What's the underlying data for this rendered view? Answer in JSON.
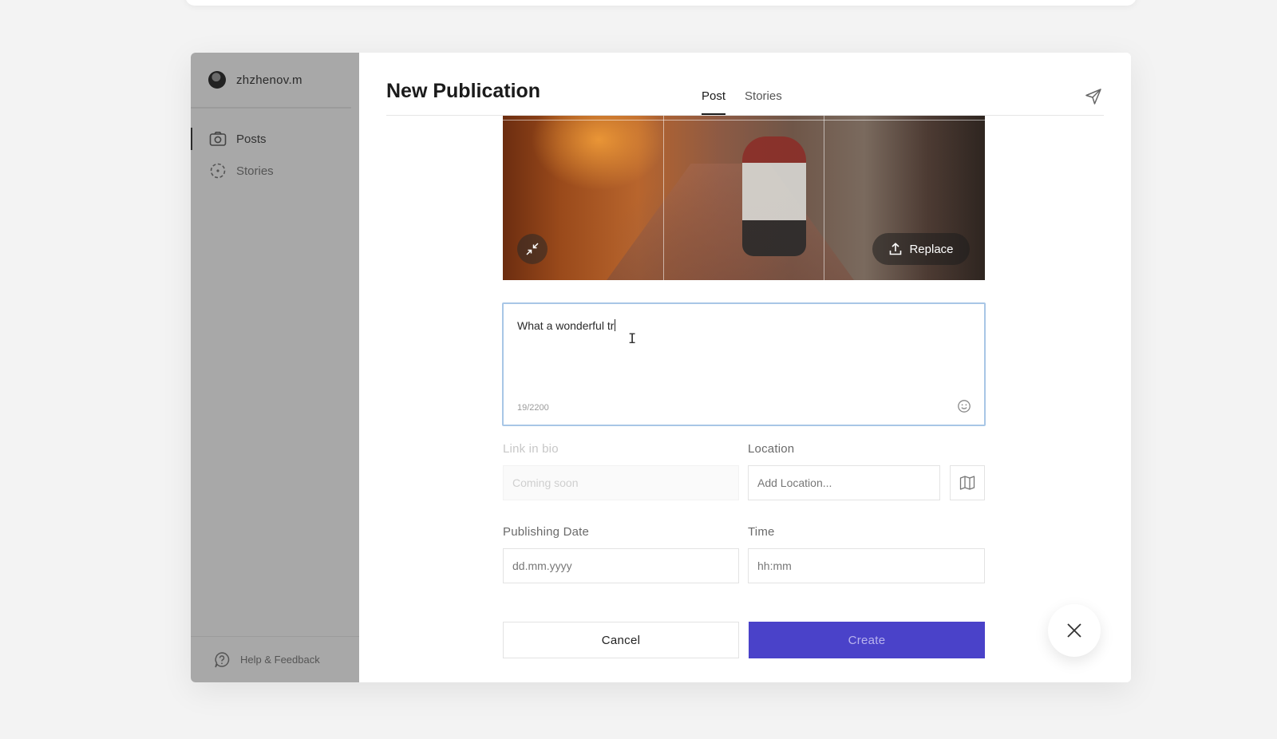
{
  "sidebar": {
    "user_name": "zhzhenov.m",
    "items": [
      {
        "label": "Posts",
        "icon": "camera-icon",
        "active": true
      },
      {
        "label": "Stories",
        "icon": "stories-circle-icon",
        "active": false
      }
    ],
    "help_label": "Help & Feedback"
  },
  "header": {
    "title": "New Publication",
    "tabs": [
      {
        "label": "Post",
        "active": true
      },
      {
        "label": "Stories",
        "active": false
      }
    ],
    "send_icon": "send-icon"
  },
  "media": {
    "replace_label": "Replace",
    "collapse_icon": "collapse-icon"
  },
  "caption": {
    "value": "What a wonderful tr",
    "counter": "19/2200",
    "emoji_icon": "smiley-icon"
  },
  "form": {
    "link_label": "Link in bio",
    "link_placeholder": "Coming soon",
    "location_label": "Location",
    "location_placeholder": "Add Location...",
    "map_icon": "map-icon",
    "date_label": "Publishing Date",
    "date_placeholder": "dd.mm.yyyy",
    "time_label": "Time",
    "time_placeholder": "hh:mm"
  },
  "actions": {
    "cancel_label": "Cancel",
    "create_label": "Create"
  },
  "colors": {
    "accent": "#4a42c9",
    "focus_border": "#a8c6e6",
    "sidebar_bg": "#a8a8a8"
  }
}
